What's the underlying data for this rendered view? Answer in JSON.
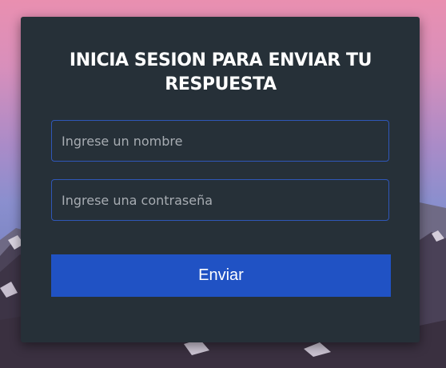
{
  "login_form": {
    "title": "INICIA SESION PARA ENVIAR TU RESPUESTA",
    "name_placeholder": "Ingrese un nombre",
    "password_placeholder": "Ingrese una contraseña",
    "submit_label": "Enviar"
  },
  "colors": {
    "card_background": "#263038",
    "button": "#2052c4",
    "field_border": "#2f57b8"
  }
}
